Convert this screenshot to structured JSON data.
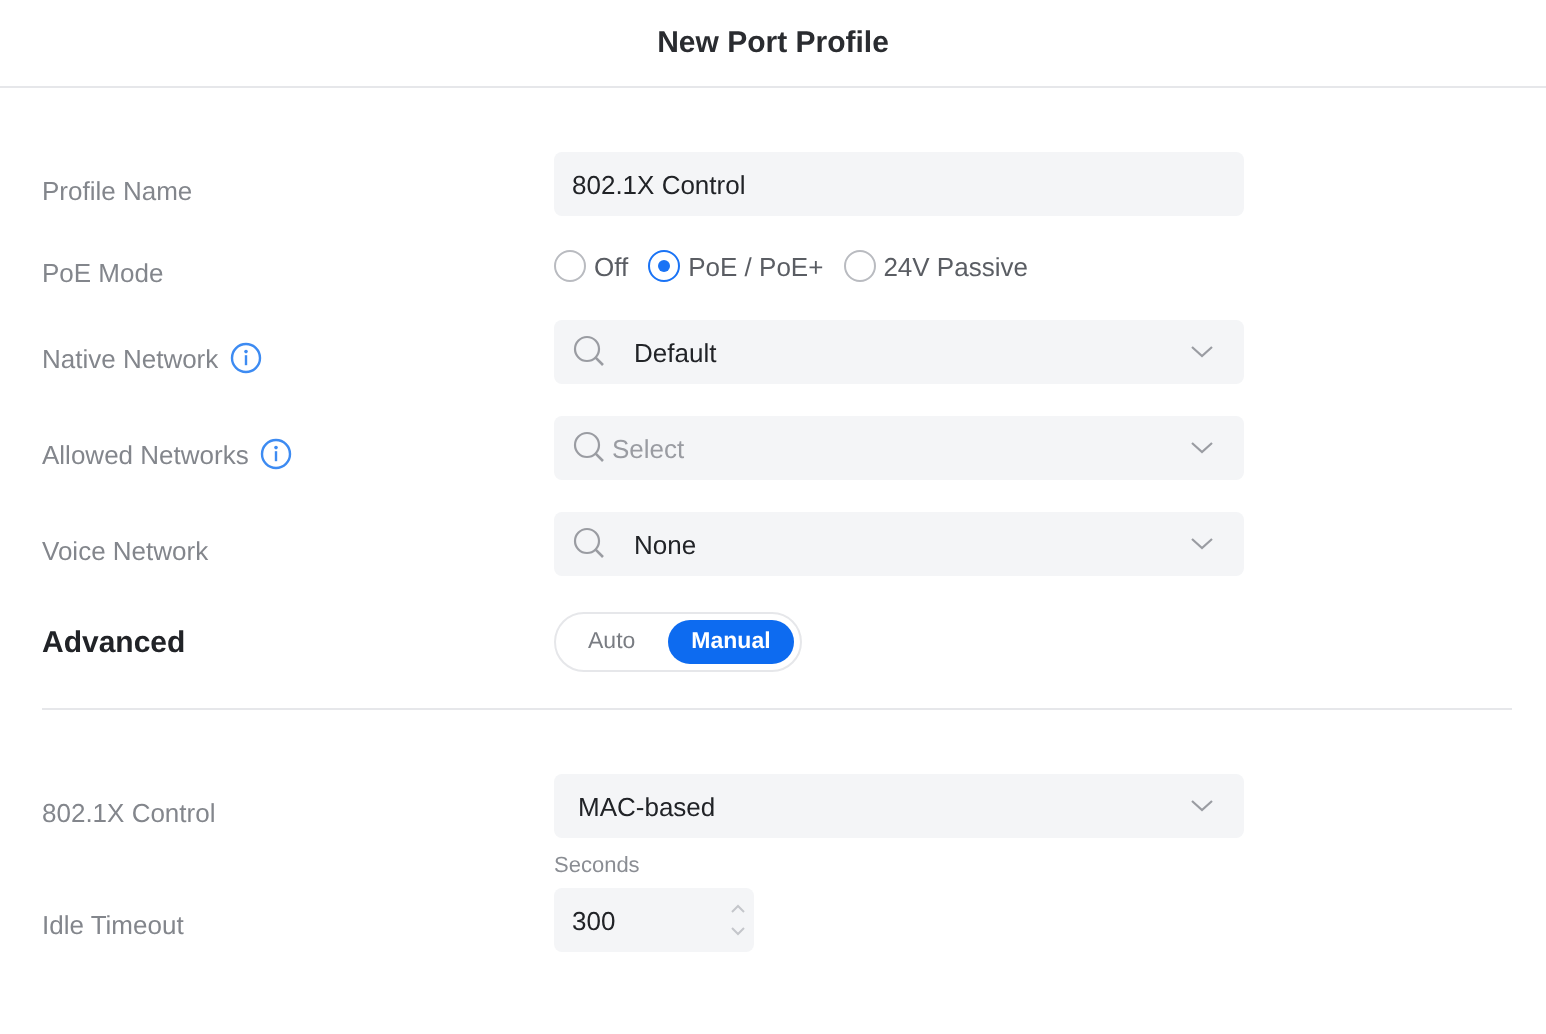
{
  "title": "New Port Profile",
  "fields": [
    {
      "kind": "text",
      "label": "Profile Name",
      "value": "802.1X Control"
    },
    {
      "kind": "radio",
      "label": "PoE Mode",
      "options": [
        {
          "label": "Off",
          "selected": false
        },
        {
          "label": "PoE / PoE+",
          "selected": true
        },
        {
          "label": "24V Passive",
          "selected": false
        }
      ]
    },
    {
      "kind": "select",
      "label": "Native Network",
      "info": true,
      "search": true,
      "value": "Default"
    },
    {
      "kind": "select",
      "label": "Allowed Networks",
      "info": true,
      "search": true,
      "placeholder": "Select"
    },
    {
      "kind": "select",
      "label": "Voice Network",
      "info": false,
      "search": true,
      "value": "None"
    }
  ],
  "advanced": {
    "title": "Advanced",
    "modes": [
      {
        "label": "Auto",
        "selected": false
      },
      {
        "label": "Manual",
        "selected": true
      }
    ]
  },
  "advanced_fields": [
    {
      "kind": "select",
      "label": "802.1X Control",
      "info": false,
      "search": false,
      "value": "MAC-based"
    },
    {
      "kind": "number",
      "label": "Idle Timeout",
      "unit": "Seconds",
      "value": "300"
    }
  ]
}
